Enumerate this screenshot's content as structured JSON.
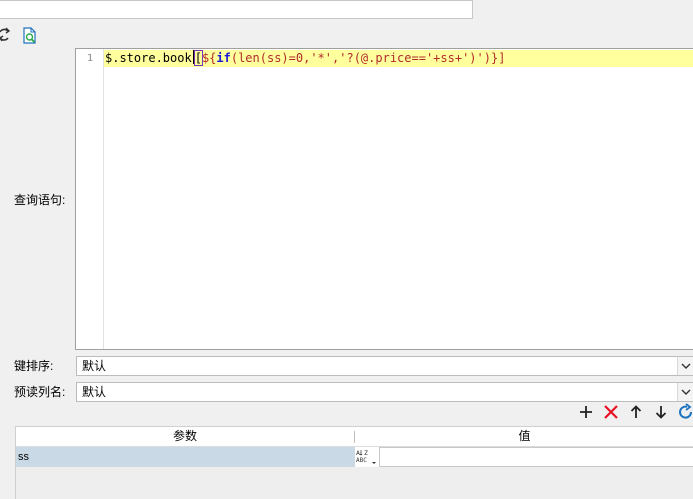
{
  "toolbar": {
    "refresh_icon": "refresh-icon",
    "search_file_icon": "search-file-icon"
  },
  "query": {
    "label": "查询语句:",
    "line_number": "1",
    "code": {
      "prefix": "$.store.book",
      "open_bracket": "[",
      "dollar_brace": "${",
      "func": "if",
      "arg_part": "(len(ss)=0,",
      "str1": "'*'",
      "comma": ",",
      "str2": "'?(@.price=='",
      "concat": "+ss+",
      "str3": "')'",
      "close": ")}]"
    }
  },
  "key_sort": {
    "label": "键排序:",
    "value": "默认"
  },
  "preread_column": {
    "label": "预读列名:",
    "value": "默认"
  },
  "param_toolbar": {
    "add_icon": "plus-icon",
    "delete_icon": "delete-x-icon",
    "up_icon": "arrow-up-icon",
    "down_icon": "arrow-down-icon",
    "refresh_icon": "refresh-icon"
  },
  "params_table": {
    "columns": [
      "参数",
      "值"
    ],
    "rows": [
      {
        "name": "ss",
        "type_icon": "abc-type-icon",
        "value": ""
      }
    ]
  },
  "colors": {
    "current_line": "#ffff9e",
    "selected_cell": "#cad9e6",
    "delete_red": "#e81123",
    "refresh_blue": "#1e73be"
  }
}
